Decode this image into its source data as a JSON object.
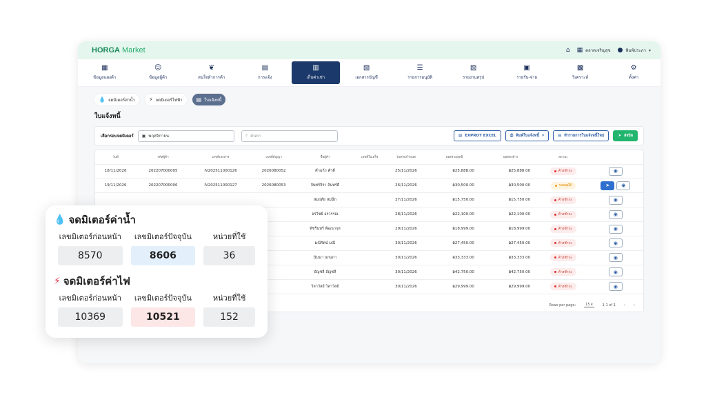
{
  "brand": {
    "logo_prefix": "HORGA",
    "logo_suffix": " Market"
  },
  "topbar": {
    "home_icon": "home-icon",
    "market_label": "ตลาดเจริญสุข",
    "user_label": "พิมพ์ประภา"
  },
  "menu": [
    {
      "label": "ข้อมูลแผงค้า",
      "icon": "store-icon"
    },
    {
      "label": "ข้อมูลผู้ค้า",
      "icon": "users-icon"
    },
    {
      "label": "สนใจทำการค้า",
      "icon": "leaf-icon"
    },
    {
      "label": "การแจ้ง",
      "icon": "clipboard-icon"
    },
    {
      "label": "เก็บค่าเช่า",
      "icon": "receipt-icon",
      "active": true
    },
    {
      "label": "เอกสารบัญชี",
      "icon": "document-icon"
    },
    {
      "label": "รายการอนุมัติ",
      "icon": "approve-icon"
    },
    {
      "label": "รายงานสรุป",
      "icon": "report-icon"
    },
    {
      "label": "รายรับ-จ่าย",
      "icon": "wallet-icon"
    },
    {
      "label": "วิเคราะห์",
      "icon": "chart-icon"
    },
    {
      "label": "ตั้งค่า",
      "icon": "gear-icon"
    }
  ],
  "subtabs": {
    "water": "จดมิเตอร์ค่าน้ำ",
    "electric": "จดมิเตอร์ไฟฟ้า",
    "invoice": "ใบแจ้งหนี้"
  },
  "section_title": "ใบแจ้งหนี้",
  "filters": {
    "round_label": "เลือกรอบจดมิเตอร์",
    "month_value": "พฤศจิกายน",
    "search_placeholder": "ค้นหา",
    "export_label": "EXPROT EXCEL",
    "print_label": "พิมพ์ใบแจ้งหนี้",
    "create_label": "ทำรายการใบแจ้งหนี้ใหม่",
    "send_label": "ส่งบิล"
  },
  "table": {
    "headers": [
      "วันที่",
      "รหัสผู้ค้า",
      "เลขที่เอกสาร",
      "เลขที่สัญญา",
      "ชื่อผู้ค้า",
      "เลขที่ใบเสร็จ",
      "วันครบกำหนด",
      "ยอดรวมสุทธิ",
      "ยอดคงค้าง",
      "สถานะ",
      ""
    ],
    "rows": [
      {
        "date": "18/11/2026",
        "code": "202207000005",
        "doc": "IV202511000126",
        "contract": "2026080052",
        "name": "คำแก้ว คำดี",
        "receipt": "",
        "due": "25/11/2026",
        "total": "฿25,888.00",
        "balance": "฿25,888.00",
        "status": "ค้างชำระ"
      },
      {
        "date": "19/11/2026",
        "code": "202207000006",
        "doc": "IV202511000127",
        "contract": "2026080053",
        "name": "จันทร์จิรา จันทร์ดี",
        "receipt": "",
        "due": "26/11/2026",
        "total": "฿30,500.00",
        "balance": "฿30,500.00",
        "status": "รออนุมัติ",
        "pending": true
      },
      {
        "date": "",
        "code": "",
        "doc": "",
        "contract": "",
        "name": "สมฤทัย สมนึก",
        "receipt": "",
        "due": "27/11/2026",
        "total": "฿15,750.00",
        "balance": "฿15,750.00",
        "status": "ค้างชำระ"
      },
      {
        "date": "",
        "code": "",
        "doc": "",
        "contract": "",
        "name": "อรวิชย์ อรวรรณ",
        "receipt": "",
        "due": "28/11/2026",
        "total": "฿22,100.00",
        "balance": "฿22,100.00",
        "status": "ค้างชำระ"
      },
      {
        "date": "",
        "code": "",
        "doc": "",
        "contract": "",
        "name": "พัชรินทร์ พัฒนากุล",
        "receipt": "",
        "due": "29/11/2026",
        "total": "฿18,999.00",
        "balance": "฿18,999.00",
        "status": "ค้างชำระ"
      },
      {
        "date": "",
        "code": "",
        "doc": "",
        "contract": "",
        "name": "มณีรัตน์ มณี",
        "receipt": "",
        "due": "30/11/2026",
        "total": "฿27,450.00",
        "balance": "฿27,450.00",
        "status": "ค้างชำระ"
      },
      {
        "date": "",
        "code": "",
        "doc": "",
        "contract": "",
        "name": "นันนา นกนภา",
        "receipt": "",
        "due": "30/11/2026",
        "total": "฿33,333.00",
        "balance": "฿33,333.00",
        "status": "ค้างชำระ"
      },
      {
        "date": "",
        "code": "",
        "doc": "",
        "contract": "",
        "name": "อัญชลี อัญชลี",
        "receipt": "",
        "due": "30/11/2026",
        "total": "฿42,750.00",
        "balance": "฿42,750.00",
        "status": "ค้างชำระ"
      },
      {
        "date": "",
        "code": "",
        "doc": "",
        "contract": "",
        "name": "วิลาวัลย์ วิลาวัลย์",
        "receipt": "",
        "due": "30/11/2026",
        "total": "฿29,999.00",
        "balance": "฿29,999.00",
        "status": "ค้างชำระ"
      }
    ]
  },
  "pager": {
    "rows_label": "Rows per page:",
    "rows_value": "15",
    "range": "1-1 of 1"
  },
  "meter": {
    "water_title": "จดมิเตอร์ค่าน้ำ",
    "electric_title": "จดมิเตอร์ค่าไฟ",
    "col_prev": "เลขมิเตอร์ก่อนหน้า",
    "col_cur": "เลขมิเตอร์ปัจจุบัน",
    "col_used": "หน่วยที่ใช้",
    "water": {
      "prev": "8570",
      "cur": "8606",
      "used": "36"
    },
    "electric": {
      "prev": "10369",
      "cur": "10521",
      "used": "152"
    }
  },
  "colors": {
    "accent": "#1b3a6b",
    "brand_green": "#21b56d",
    "topbar_bg": "#e4f6ee"
  }
}
